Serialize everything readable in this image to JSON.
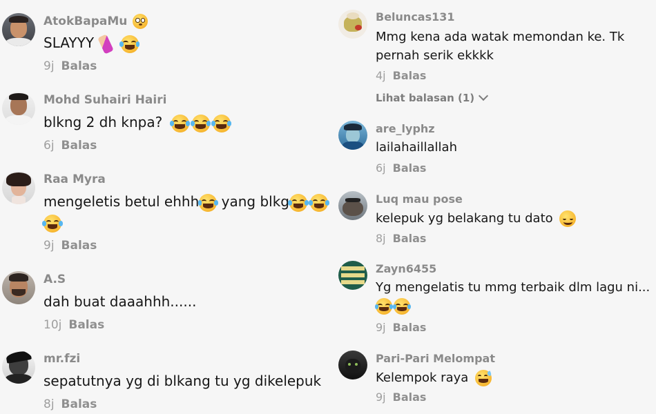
{
  "left_comments": [
    {
      "username": "AtokBapaMu",
      "text": "SLAYYY",
      "time": "9j",
      "reply_label": "Balas"
    },
    {
      "username": "Mohd Suhairi Hairi",
      "text": "blkng 2 dh knpa?",
      "time": "6j",
      "reply_label": "Balas"
    },
    {
      "username": "Raa Myra",
      "text_line1_a": "mengeletis betul ehhh",
      "text_line1_b": " yang blkg",
      "time": "9j",
      "reply_label": "Balas"
    },
    {
      "username": "A.S",
      "text": "dah buat daaahhh......",
      "time": "10j",
      "reply_label": "Balas"
    },
    {
      "username": "mr.fzi",
      "text": "sepatutnya yg di blkang tu yg dikelepuk",
      "time": "8j",
      "reply_label": "Balas"
    }
  ],
  "right_comments": [
    {
      "username": "Beluncas131",
      "text_line1": "Mmg kena ada watak memondan ke. Tk",
      "text_line2": "pernah serik ekkkk",
      "time": "4j",
      "reply_label": "Balas",
      "view_replies": "Lihat balasan (1)"
    },
    {
      "username": "are_lyphz",
      "text": "lailahaillallah",
      "time": "6j",
      "reply_label": "Balas"
    },
    {
      "username": "Luq mau pose",
      "text": "kelepuk yg belakang tu dato",
      "time": "8j",
      "reply_label": "Balas"
    },
    {
      "username": "Zayn6455",
      "text": "Yg mengelatis tu mmg terbaik dlm lagu ni...",
      "time": "9j",
      "reply_label": "Balas"
    },
    {
      "username": "Pari-Pari Melompat",
      "text": "Kelempok raya",
      "time": "9j",
      "reply_label": "Balas"
    }
  ],
  "colors": {
    "background": "#f6f6f6",
    "username": "#8a8a8a",
    "text": "#161616",
    "meta": "#9a9a9a"
  },
  "icons": [
    "laughing-tears-emoji",
    "nail-polish-emoji",
    "flushed-emoji",
    "relieved-emoji",
    "sweat-smile-emoji",
    "chevron-down-icon"
  ]
}
